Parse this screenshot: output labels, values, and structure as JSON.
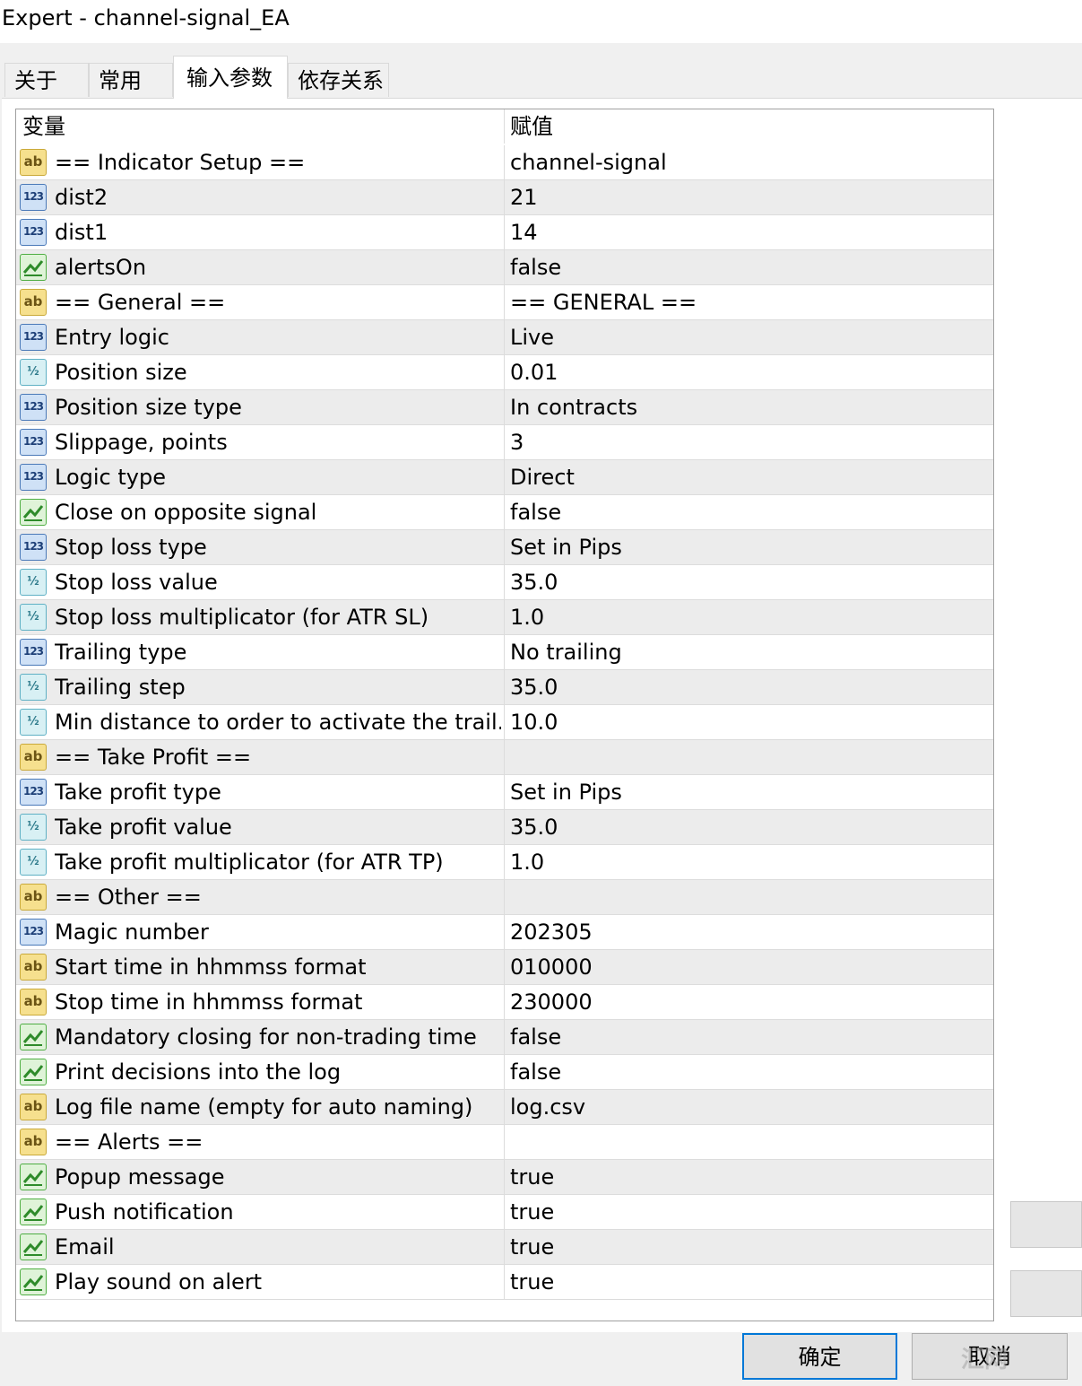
{
  "window": {
    "title": "Expert - channel-signal_EA"
  },
  "tabs": [
    {
      "label": "关于",
      "active": false
    },
    {
      "label": "常用",
      "active": false
    },
    {
      "label": "输入参数",
      "active": true
    },
    {
      "label": "依存关系",
      "active": false
    }
  ],
  "grid": {
    "columns": {
      "variable": "变量",
      "value": "赋值"
    },
    "rows": [
      {
        "type": "string",
        "icon": "ab-string-icon",
        "name": "== Indicator Setup ==",
        "value": "channel-signal"
      },
      {
        "type": "int",
        "icon": "123-integer-icon",
        "name": "dist2",
        "value": "21"
      },
      {
        "type": "int",
        "icon": "123-integer-icon",
        "name": "dist1",
        "value": "14"
      },
      {
        "type": "bool",
        "icon": "bool-icon",
        "name": "alertsOn",
        "value": "false"
      },
      {
        "type": "string",
        "icon": "ab-string-icon",
        "name": "== General ==",
        "value": "== GENERAL =="
      },
      {
        "type": "int",
        "icon": "123-integer-icon",
        "name": "Entry logic",
        "value": "Live"
      },
      {
        "type": "double",
        "icon": "half-double-icon",
        "name": "Position size",
        "value": "0.01"
      },
      {
        "type": "int",
        "icon": "123-integer-icon",
        "name": "Position size type",
        "value": "In contracts"
      },
      {
        "type": "int",
        "icon": "123-integer-icon",
        "name": "Slippage, points",
        "value": "3"
      },
      {
        "type": "int",
        "icon": "123-integer-icon",
        "name": "Logic type",
        "value": "Direct"
      },
      {
        "type": "bool",
        "icon": "bool-icon",
        "name": "Close on opposite signal",
        "value": "false"
      },
      {
        "type": "int",
        "icon": "123-integer-icon",
        "name": "Stop loss type",
        "value": "Set in Pips"
      },
      {
        "type": "double",
        "icon": "half-double-icon",
        "name": "Stop loss value",
        "value": "35.0"
      },
      {
        "type": "double",
        "icon": "half-double-icon",
        "name": "Stop loss multiplicator (for ATR SL)",
        "value": "1.0"
      },
      {
        "type": "int",
        "icon": "123-integer-icon",
        "name": "Trailing type",
        "value": "No trailing"
      },
      {
        "type": "double",
        "icon": "half-double-icon",
        "name": "Trailing step",
        "value": "35.0"
      },
      {
        "type": "double",
        "icon": "half-double-icon",
        "name": "Min distance to order to activate the trail...",
        "value": "10.0"
      },
      {
        "type": "string",
        "icon": "ab-string-icon",
        "name": "== Take Profit ==",
        "value": ""
      },
      {
        "type": "int",
        "icon": "123-integer-icon",
        "name": "Take profit type",
        "value": "Set in Pips"
      },
      {
        "type": "double",
        "icon": "half-double-icon",
        "name": "Take profit value",
        "value": "35.0"
      },
      {
        "type": "double",
        "icon": "half-double-icon",
        "name": "Take profit multiplicator (for ATR TP)",
        "value": "1.0"
      },
      {
        "type": "string",
        "icon": "ab-string-icon",
        "name": "== Other ==",
        "value": ""
      },
      {
        "type": "int",
        "icon": "123-integer-icon",
        "name": "Magic number",
        "value": "202305"
      },
      {
        "type": "string",
        "icon": "ab-string-icon",
        "name": "Start time in hhmmss format",
        "value": "010000"
      },
      {
        "type": "string",
        "icon": "ab-string-icon",
        "name": "Stop time in hhmmss format",
        "value": "230000"
      },
      {
        "type": "bool",
        "icon": "bool-icon",
        "name": "Mandatory closing for non-trading time",
        "value": "false"
      },
      {
        "type": "bool",
        "icon": "bool-icon",
        "name": "Print decisions into the log",
        "value": "false"
      },
      {
        "type": "string",
        "icon": "ab-string-icon",
        "name": "Log file name (empty for auto naming)",
        "value": "log.csv"
      },
      {
        "type": "string",
        "icon": "ab-string-icon",
        "name": "== Alerts ==",
        "value": ""
      },
      {
        "type": "bool",
        "icon": "bool-icon",
        "name": "Popup message",
        "value": "true"
      },
      {
        "type": "bool",
        "icon": "bool-icon",
        "name": "Push notification",
        "value": "true"
      },
      {
        "type": "bool",
        "icon": "bool-icon",
        "name": "Email",
        "value": "true"
      },
      {
        "type": "bool",
        "icon": "bool-icon",
        "name": "Play sound on alert",
        "value": "true"
      }
    ]
  },
  "buttons": {
    "ok": "确定",
    "cancel": "取消"
  },
  "watermark": "汇网",
  "colors": {
    "ok_border": "#0078d7",
    "alt_row": "#ececec"
  }
}
